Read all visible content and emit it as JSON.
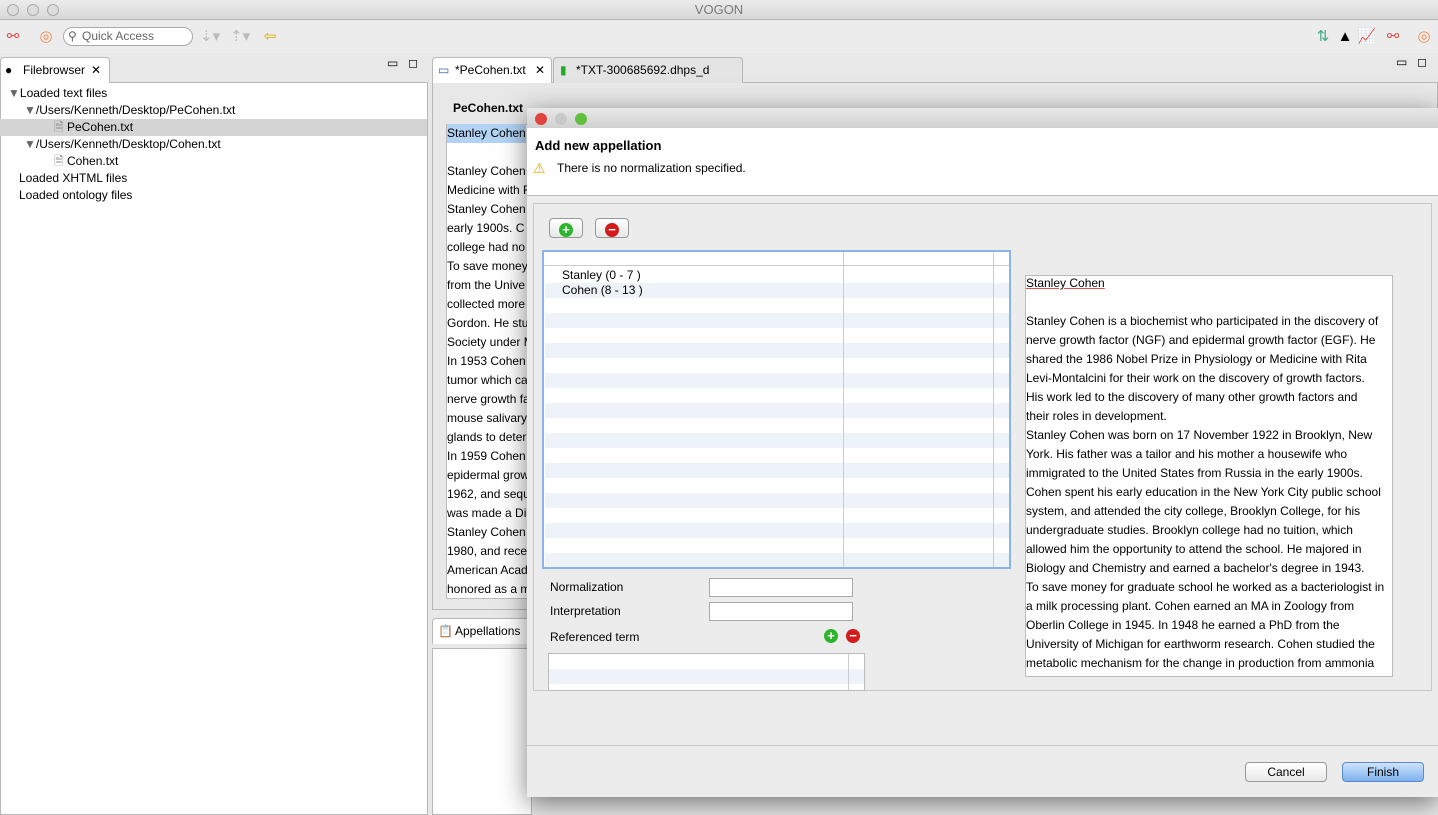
{
  "window": {
    "title": "VOGON"
  },
  "toolbar": {
    "quick_access_placeholder": "Quick Access"
  },
  "filebrowser": {
    "tab_label": "Filebrowser",
    "tree": [
      {
        "label": "Loaded text files",
        "level": 0,
        "expanded": true
      },
      {
        "label": "/Users/Kenneth/Desktop/PeCohen.txt",
        "level": 1,
        "expanded": true
      },
      {
        "label": "PeCohen.txt",
        "level": 2,
        "selected": true
      },
      {
        "label": "/Users/Kenneth/Desktop/Cohen.txt",
        "level": 1,
        "expanded": true
      },
      {
        "label": "Cohen.txt",
        "level": 2
      },
      {
        "label": "Loaded XHTML files",
        "level": 0
      },
      {
        "label": "Loaded ontology files",
        "level": 0
      }
    ]
  },
  "editor": {
    "tabs": [
      {
        "label": "*PeCohen.txt",
        "active": true
      },
      {
        "label": "*TXT-300685692.dhps_d",
        "active": false
      }
    ],
    "heading": "PeCohen.txt",
    "lines": [
      "Stanley Cohen",
      "",
      "Stanley Cohen",
      "Medicine with R",
      "Stanley Cohen w",
      "early 1900s.  C",
      "college had no",
      "To save money",
      "from the Unive",
      "collected more",
      "Gordon.  He stu",
      "Society under M",
      "In 1953 Cohen",
      "tumor which ca",
      "nerve growth fa",
      "mouse salivary",
      "glands to deter",
      "In 1959 Cohen",
      "epidermal grow",
      "1962, and sequ",
      "was made a Dis",
      "Stanley Cohen",
      "1980, and rece",
      "American Acad",
      "honored as a m"
    ]
  },
  "appellations": {
    "tab_label": "Appellations"
  },
  "dialog": {
    "title": "Add new appellation",
    "message": "There is no normalization specified.",
    "table_rows": [
      "Stanley (0 - 7 )",
      "Cohen (8 - 13 )"
    ],
    "normalization_label": "Normalization",
    "normalization_value": "",
    "interpretation_label": "Interpretation",
    "interpretation_value": "",
    "referenced_term_label": "Referenced term",
    "preview_title": "Stanley Cohen",
    "preview_lines": [
      "Stanley Cohen is a biochemist who participated in the discovery of",
      "nerve growth factor (NGF) and epidermal growth factor (EGF).  He",
      "shared the 1986 Nobel Prize in Physiology or Medicine with Rita",
      "Levi-Montalcini for their work on the discovery of growth factors.",
      "His work led to the discovery of many other growth factors and",
      "their roles in development.",
      "Stanley Cohen was born on 17 November 1922 in Brooklyn, New",
      "York.  His father was a tailor and his mother a housewife who",
      "immigrated to the United States from Russia in the early 1900s.",
      "Cohen spent his early education in the New York City public school",
      "system, and attended the city college, Brooklyn College, for his",
      "undergraduate studies.  Brooklyn college had no tuition, which",
      "allowed him the opportunity to attend the school.   He majored in",
      "Biology and Chemistry and earned a bachelor's degree in 1943.",
      "To save money for graduate school he worked as a bacteriologist in",
      "a milk processing plant.  Cohen earned an MA in Zoology from",
      "Oberlin College in 1945.  In 1948 he earned a PhD from the",
      "University of Michigan for earthworm research.  Cohen studied the",
      "metabolic mechanism for the change in production from ammonia"
    ],
    "cancel_label": "Cancel",
    "finish_label": "Finish"
  },
  "colors": {
    "selection": "#b3d3f5",
    "accent": "#5b9bd5",
    "add": "#2db52d",
    "remove": "#d21c1c"
  }
}
